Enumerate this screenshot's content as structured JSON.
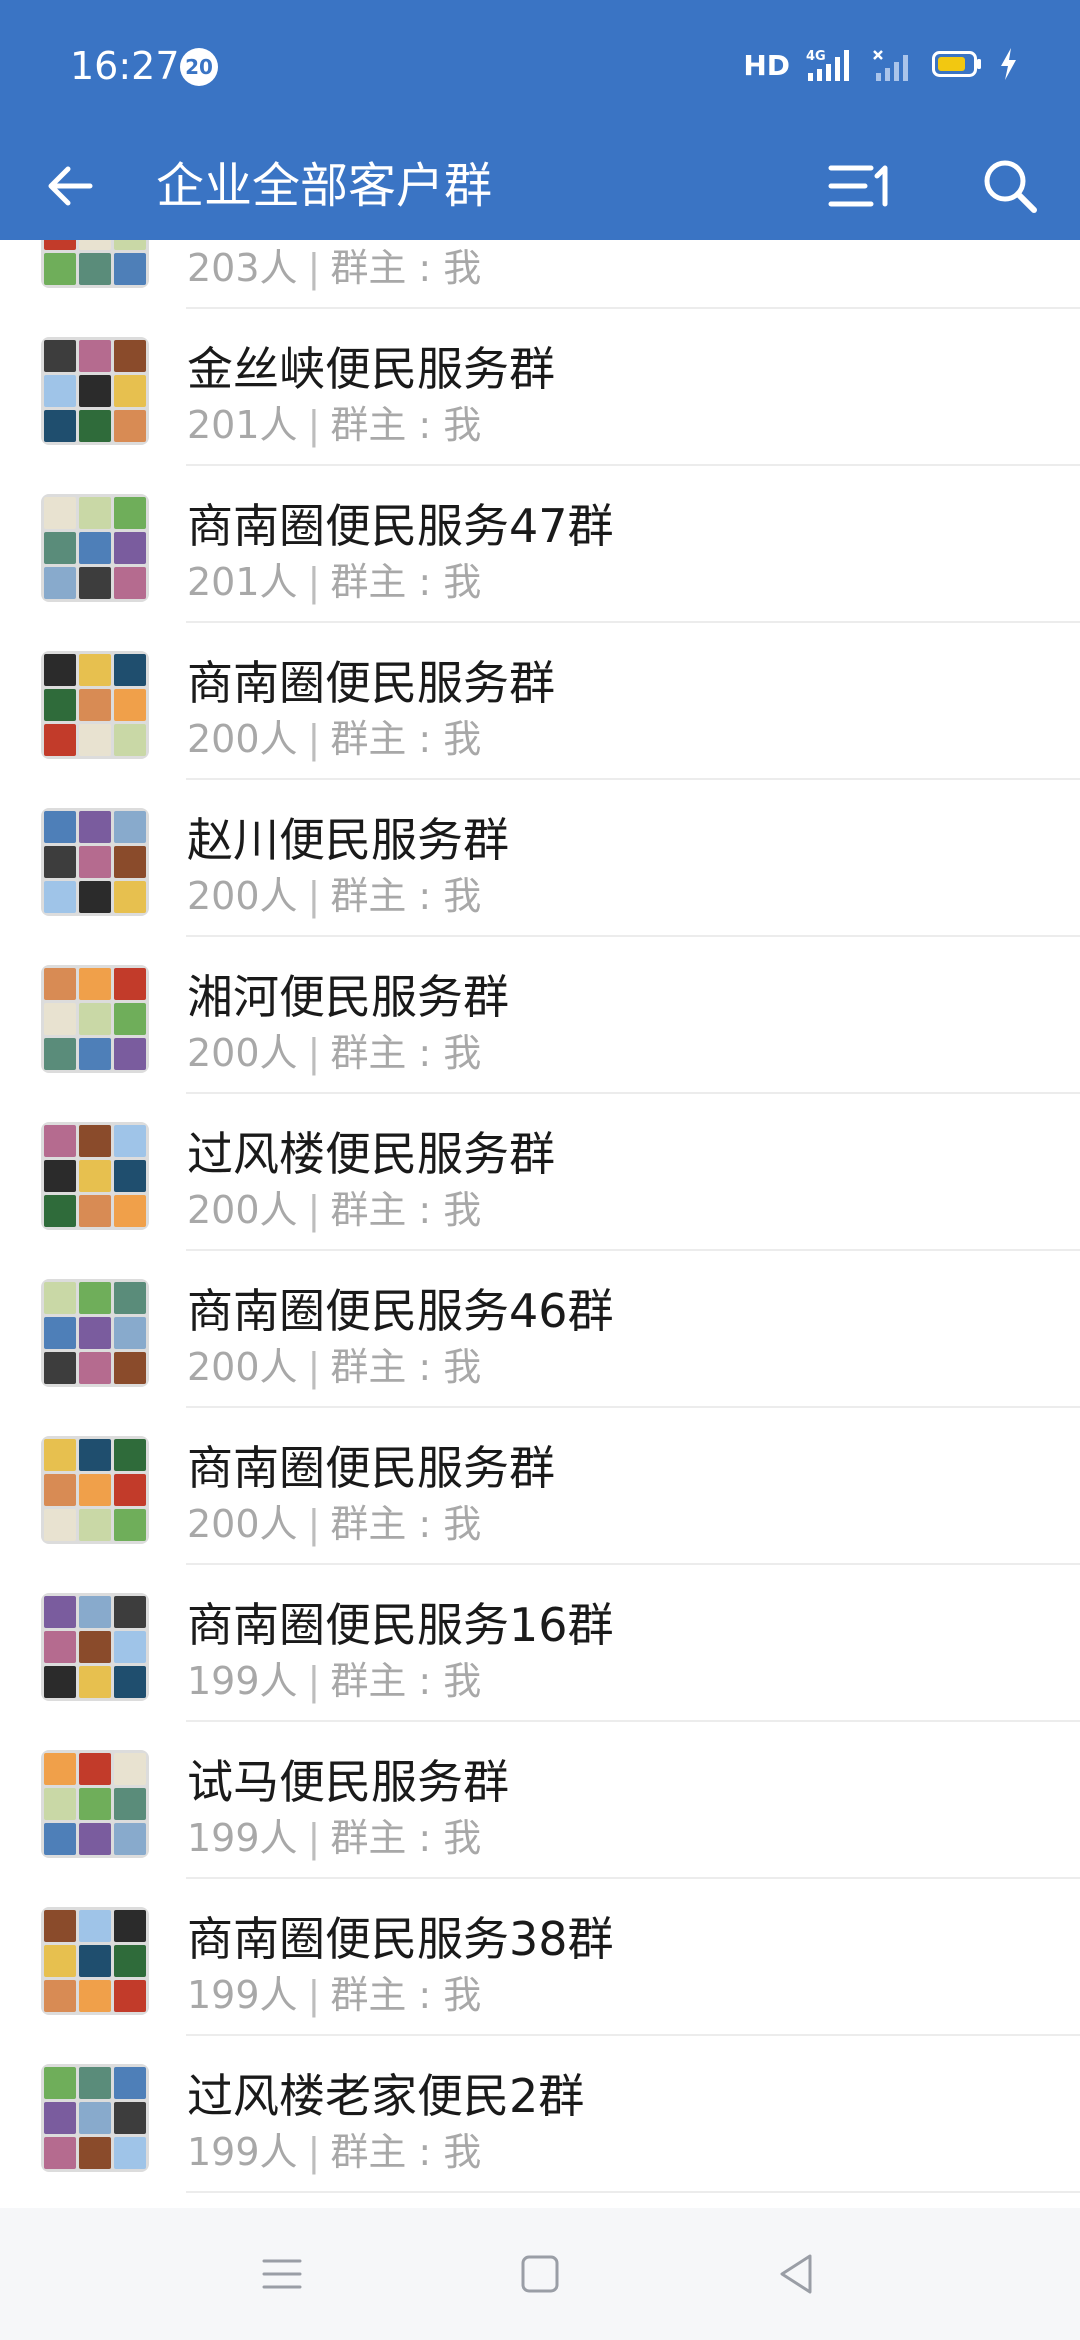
{
  "status_bar": {
    "time": "16:27",
    "notification_count": "20",
    "network_label": "HD",
    "signal_label": "4G"
  },
  "header": {
    "title": "企业全部客户群"
  },
  "groups": [
    {
      "name": "",
      "member_count": "203人",
      "owner": "群主 : 我"
    },
    {
      "name": "金丝峡便民服务群",
      "member_count": "201人",
      "owner": "群主 : 我"
    },
    {
      "name": "商南圈便民服务47群",
      "member_count": "201人",
      "owner": "群主 : 我"
    },
    {
      "name": "商南圈便民服务群",
      "member_count": "200人",
      "owner": "群主 : 我"
    },
    {
      "name": "赵川便民服务群",
      "member_count": "200人",
      "owner": "群主 : 我"
    },
    {
      "name": "湘河便民服务群",
      "member_count": "200人",
      "owner": "群主 : 我"
    },
    {
      "name": "过风楼便民服务群",
      "member_count": "200人",
      "owner": "群主 : 我"
    },
    {
      "name": "商南圈便民服务46群",
      "member_count": "200人",
      "owner": "群主 : 我"
    },
    {
      "name": "商南圈便民服务群",
      "member_count": "200人",
      "owner": "群主 : 我"
    },
    {
      "name": "商南圈便民服务16群",
      "member_count": "199人",
      "owner": "群主 : 我"
    },
    {
      "name": "试马便民服务群",
      "member_count": "199人",
      "owner": "群主 : 我"
    },
    {
      "name": "商南圈便民服务38群",
      "member_count": "199人",
      "owner": "群主 : 我"
    },
    {
      "name": "过风楼老家便民2群",
      "member_count": "199人",
      "owner": "群主 : 我"
    }
  ],
  "colors": {
    "header_bg": "#3a74c4",
    "name_text": "#1a1a1a",
    "meta_text": "#a8a8a8",
    "divider": "#ececec",
    "navbar_bg": "#f6f7f9",
    "battery_fill": "#f2c811"
  },
  "icons": {
    "back": "arrow-left-icon",
    "sort": "sort-icon",
    "search": "search-icon",
    "nav_menu": "menu-icon",
    "nav_home": "square-icon",
    "nav_back": "triangle-back-icon"
  }
}
